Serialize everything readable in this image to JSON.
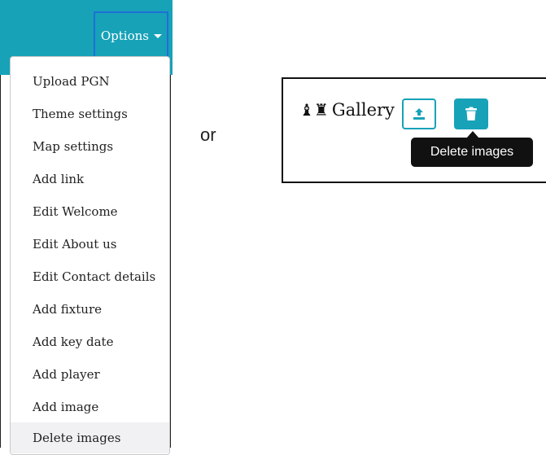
{
  "left_panel": {
    "options_label": "Options",
    "menu_items": [
      "Upload PGN",
      "Theme settings",
      "Map settings",
      "Add link",
      "Edit Welcome",
      "Edit About us",
      "Edit Contact details",
      "Add fixture",
      "Add key date",
      "Add player",
      "Add image",
      "Delete images"
    ],
    "active_item": "Delete images"
  },
  "separator_text": "or",
  "gallery": {
    "title": "Gallery",
    "icon_glyph": "♝♜",
    "upload_icon": "upload-icon",
    "delete_icon": "trash-icon",
    "tooltip": "Delete images"
  },
  "colors": {
    "accent": "#17a2b8",
    "focus_outline": "#1f6fd6",
    "tooltip_bg": "#111111"
  }
}
